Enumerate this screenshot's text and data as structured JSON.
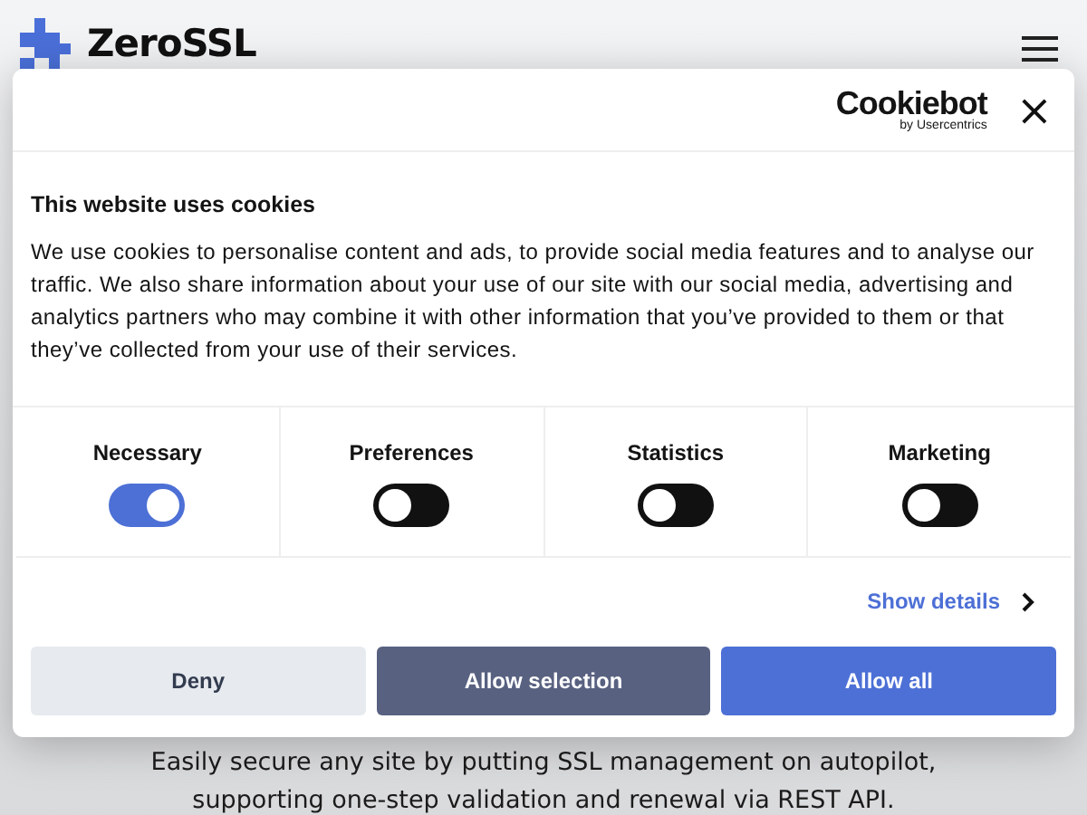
{
  "site": {
    "logo": "ZeroSSL",
    "tagline": [
      "Easily secure any site by putting SSL management on autopilot,",
      "supporting one-step validation and renewal via REST API."
    ]
  },
  "dialog": {
    "brand": "Cookiebot",
    "brand_byline": "by Usercentrics",
    "close": "×",
    "title": "This website uses cookies",
    "text": "We use cookies to personalise content and ads, to provide social media features and to analyse our traffic. We also share information about your use of our site with our social media, advertising and analytics partners who may combine it with other information that you’ve provided to them or that they’ve collected from your use of their services.",
    "categories": [
      {
        "label": "Necessary",
        "on": true
      },
      {
        "label": "Preferences",
        "on": false
      },
      {
        "label": "Statistics",
        "on": false
      },
      {
        "label": "Marketing",
        "on": false
      }
    ],
    "details_link": "Show details",
    "buttons": [
      {
        "label": "Deny",
        "kind": "light"
      },
      {
        "label": "Allow selection",
        "kind": "dark"
      },
      {
        "label": "Allow all",
        "kind": "primary"
      }
    ]
  }
}
